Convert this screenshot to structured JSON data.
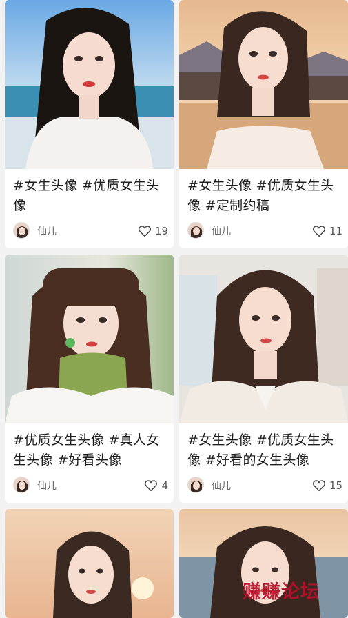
{
  "feed": {
    "cards": [
      {
        "title": "#女生头像 #优质女生头像",
        "author": "仙儿",
        "likes": "19",
        "scene": "beach-portrait-icon"
      },
      {
        "title": "#女生头像 #优质女生头像 #定制约稿",
        "author": "仙儿",
        "likes": "11",
        "scene": "sunset-temple-portrait-icon"
      },
      {
        "title": "#优质女生头像 #真人女生头像 #好看头像",
        "author": "仙儿",
        "likes": "4",
        "scene": "green-scarf-portrait-icon"
      },
      {
        "title": "#女生头像 #优质女生头像 #好看的女生头像",
        "author": "仙儿",
        "likes": "15",
        "scene": "blazer-portrait-icon"
      },
      {
        "scene": "sunset-bob-portrait-icon"
      },
      {
        "scene": "sunset-sea-portrait-icon"
      }
    ]
  },
  "watermark": "赚赚论坛",
  "icons": {
    "like": "heart-outline-icon",
    "avatar": "author-avatar"
  }
}
